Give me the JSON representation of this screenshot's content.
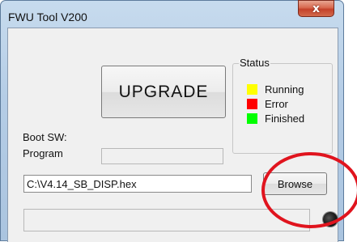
{
  "window": {
    "title": "FWU Tool V200",
    "close_label": "x"
  },
  "main": {
    "upgrade_label": "UPGRADE",
    "boot_sw_label": "Boot SW:",
    "program_label": "Program",
    "file_path": "C:\\V4.14_SB_DISP.hex",
    "browse_label": "Browse"
  },
  "status": {
    "title": "Status",
    "items": [
      {
        "label": "Running",
        "color": "#ffff00"
      },
      {
        "label": "Error",
        "color": "#ff0000"
      },
      {
        "label": "Finished",
        "color": "#00ff00"
      }
    ]
  },
  "annotation": {
    "color": "#e0141e"
  }
}
